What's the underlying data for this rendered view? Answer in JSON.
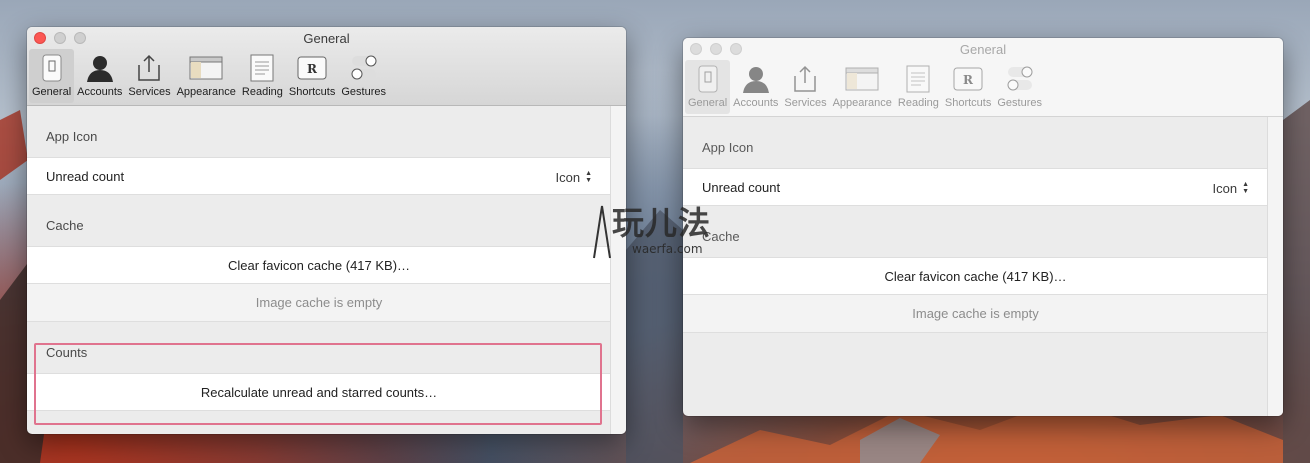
{
  "windows": [
    {
      "title": "General",
      "toolbar": [
        {
          "label": "General",
          "icon": "general-icon",
          "selected": true
        },
        {
          "label": "Accounts",
          "icon": "accounts-icon",
          "selected": false
        },
        {
          "label": "Services",
          "icon": "services-icon",
          "selected": false
        },
        {
          "label": "Appearance",
          "icon": "appearance-icon",
          "selected": false
        },
        {
          "label": "Reading",
          "icon": "reading-icon",
          "selected": false
        },
        {
          "label": "Shortcuts",
          "icon": "shortcuts-icon",
          "selected": false
        },
        {
          "label": "Gestures",
          "icon": "gestures-icon",
          "selected": false
        }
      ],
      "app_icon_header": "App Icon",
      "unread_count_label": "Unread count",
      "unread_count_value": "Icon",
      "cache_header": "Cache",
      "clear_favicon_label": "Clear favicon cache (417 KB)…",
      "image_cache_label": "Image cache is empty",
      "counts_header": "Counts",
      "recalculate_label": "Recalculate unread and starred counts…"
    },
    {
      "title": "General",
      "toolbar": [
        {
          "label": "General",
          "icon": "general-icon",
          "selected": true
        },
        {
          "label": "Accounts",
          "icon": "accounts-icon",
          "selected": false
        },
        {
          "label": "Services",
          "icon": "services-icon",
          "selected": false
        },
        {
          "label": "Appearance",
          "icon": "appearance-icon",
          "selected": false
        },
        {
          "label": "Reading",
          "icon": "reading-icon",
          "selected": false
        },
        {
          "label": "Shortcuts",
          "icon": "shortcuts-icon",
          "selected": false
        },
        {
          "label": "Gestures",
          "icon": "gestures-icon",
          "selected": false
        }
      ],
      "app_icon_header": "App Icon",
      "unread_count_label": "Unread count",
      "unread_count_value": "Icon",
      "cache_header": "Cache",
      "clear_favicon_label": "Clear favicon cache (417 KB)…",
      "image_cache_label": "Image cache is empty"
    }
  ],
  "shortcuts_icon_glyph": "R",
  "watermark": {
    "main": "玩儿法",
    "sub": "waerfa.com"
  },
  "colors": {
    "close_button": "#fc5753",
    "highlight": "#e0738e"
  }
}
